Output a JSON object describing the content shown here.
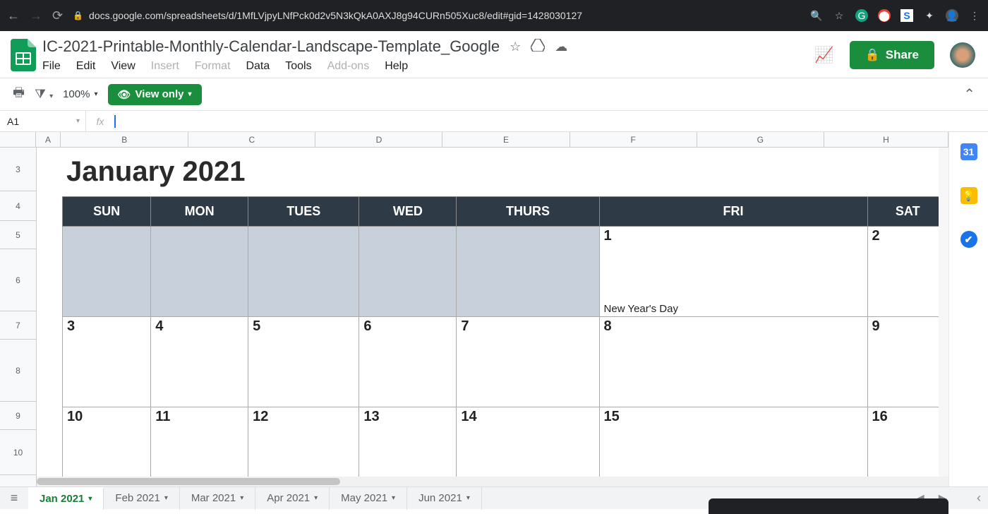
{
  "browser": {
    "url": "docs.google.com/spreadsheets/d/1MfLVjpyLNfPck0d2v5N3kQkA0AXJ8g94CURn505Xuc8/edit#gid=1428030127"
  },
  "doc": {
    "title": "IC-2021-Printable-Monthly-Calendar-Landscape-Template_Google",
    "menubar": [
      "File",
      "Edit",
      "View",
      "Insert",
      "Format",
      "Data",
      "Tools",
      "Add-ons",
      "Help"
    ],
    "share_label": "Share",
    "zoom": "100%",
    "view_only_label": "View only"
  },
  "namebox": {
    "cell": "A1"
  },
  "columns": [
    "A",
    "B",
    "C",
    "D",
    "E",
    "F",
    "G",
    "H"
  ],
  "rows_visible": [
    "3",
    "4",
    "5",
    "6",
    "7",
    "8",
    "9",
    "10"
  ],
  "calendar": {
    "month_title": "January 2021",
    "day_headers": [
      "SUN",
      "MON",
      "TUES",
      "WED",
      "THURS",
      "FRI",
      "SAT"
    ],
    "weeks": [
      {
        "dates": [
          "",
          "",
          "",
          "",
          "",
          "1",
          "2"
        ],
        "blanks": [
          true,
          true,
          true,
          true,
          true,
          false,
          false
        ],
        "events": [
          "",
          "",
          "",
          "",
          "",
          "New Year's Day",
          ""
        ]
      },
      {
        "dates": [
          "3",
          "4",
          "5",
          "6",
          "7",
          "8",
          "9"
        ],
        "blanks": [
          false,
          false,
          false,
          false,
          false,
          false,
          false
        ],
        "events": [
          "",
          "",
          "",
          "",
          "",
          "",
          ""
        ]
      },
      {
        "dates": [
          "10",
          "11",
          "12",
          "13",
          "14",
          "15",
          "16"
        ],
        "blanks": [
          false,
          false,
          false,
          false,
          false,
          false,
          false
        ],
        "events": [
          "",
          "",
          "",
          "",
          "",
          "",
          ""
        ]
      }
    ]
  },
  "sheet_tabs": [
    "Jan 2021",
    "Feb 2021",
    "Mar 2021",
    "Apr 2021",
    "May 2021",
    "Jun 2021"
  ]
}
